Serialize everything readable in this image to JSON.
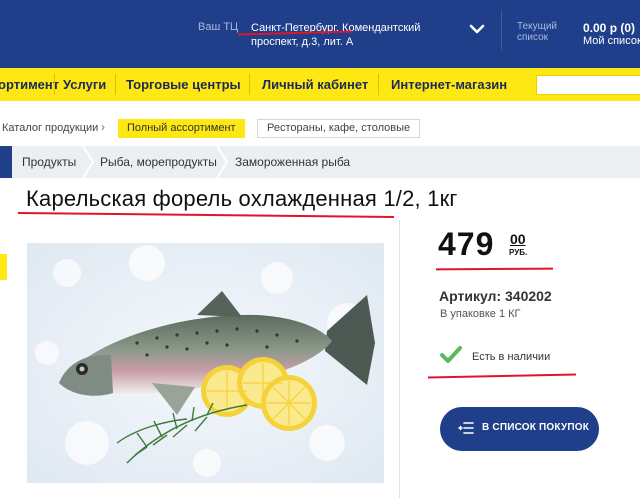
{
  "header": {
    "your_tc_label": "Ваш ТЦ",
    "address": "Санкт-Петербург, Комендантский проспект, д.3, лит. А",
    "current_list_label": "Текущий список",
    "total": "0.00 р (0)",
    "my_list": "Мой список"
  },
  "nav": {
    "items": [
      {
        "label": "ортимент"
      },
      {
        "label": "Услуги"
      },
      {
        "label": "Торговые центры"
      },
      {
        "label": "Личный кабинет"
      },
      {
        "label": "Интернет-магазин"
      }
    ]
  },
  "catalog": {
    "label": "Каталог продукции",
    "chevron": "›",
    "chips": [
      "Полный ассортимент",
      "Рестораны, кафе, столовые"
    ]
  },
  "breadcrumbs": [
    "Продукты",
    "Рыба, морепродукты",
    "Замороженная рыба"
  ],
  "product": {
    "title": "Карельская форель охлажденная 1/2, 1кг",
    "price_int": "479",
    "price_dec": "00",
    "currency": "РУБ.",
    "article": "Артикул: 340202",
    "pack": "В упаковке 1 КГ",
    "stock": "Есть в наличии",
    "add_button": "В СПИСОК ПОКУПОК"
  },
  "colors": {
    "brand_blue": "#1f3f8a",
    "brand_yellow": "#fde814",
    "accent_red": "#e1142a",
    "stock_green": "#5cb85c"
  },
  "icons": [
    "chevron-down-icon",
    "check-icon",
    "list-add-icon",
    "fish-photo"
  ]
}
